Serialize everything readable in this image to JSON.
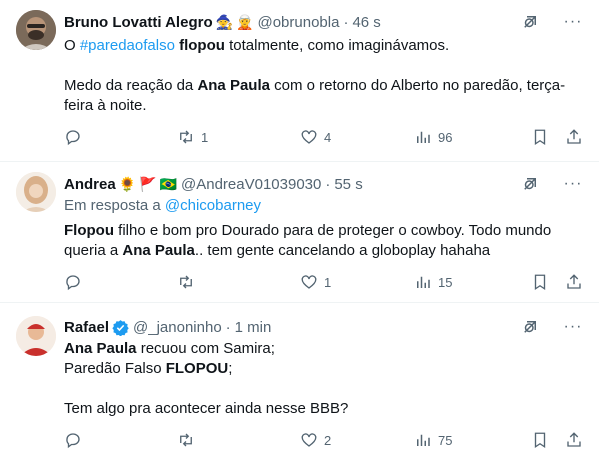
{
  "tweets": [
    {
      "name": "Bruno Lovatti Alegro",
      "name_emojis": [
        "🧙",
        "🧝"
      ],
      "handle": "@obrunobla",
      "separator": "·",
      "time": "46 s",
      "avatar_colors": [
        "#5a4a3c",
        "#b89478"
      ],
      "body": {
        "line1_pre": "O ",
        "line1_hashtag": "#paredaofalso",
        "line1_space": " ",
        "line1_bold": "flopou",
        "line1_post": " totalmente, como imaginávamos.",
        "line2_pre": "Medo da reação da ",
        "line2_bold": "Ana Paula",
        "line2_post": " com o retorno do Alberto no paredão, terça-feira à noite."
      },
      "actions": {
        "reply_count": "",
        "retweet_count": "1",
        "like_count": "4",
        "views_count": "96"
      }
    },
    {
      "name": "Andrea",
      "name_emojis": [
        "🌻",
        "🚩",
        "🇧🇷"
      ],
      "handle": "@AndreaV01039030",
      "separator": "·",
      "time": "55 s",
      "avatar_colors": [
        "#e9d9c8",
        "#c79e7a"
      ],
      "replying_prefix": "Em resposta a ",
      "replying_to": "@chicobarney",
      "body": {
        "bold1": "Flopou",
        "text1": " filho e bom pro Dourado para de proteger o cowboy.  Todo mundo queria a ",
        "bold2": "Ana Paula",
        "text2": ".. tem gente cancelando a globoplay hahaha"
      },
      "actions": {
        "reply_count": "",
        "retweet_count": "",
        "like_count": "1",
        "views_count": "15"
      }
    },
    {
      "name": "Rafael",
      "verified": true,
      "handle": "@_janoninho",
      "separator": "·",
      "time": "1 min",
      "avatar_colors": [
        "#c9302c",
        "#f1d3be"
      ],
      "body": {
        "l1_bold": "Ana Paula",
        "l1_text": " recuou com Samira;",
        "l2_text": "Paredão Falso ",
        "l2_bold": "FLOPOU",
        "l2_end": ";",
        "l3_text": "Tem algo pra acontecer ainda nesse BBB?"
      },
      "actions": {
        "reply_count": "",
        "retweet_count": "",
        "like_count": "2",
        "views_count": "75"
      }
    }
  ],
  "icons": {
    "reply": "reply-icon",
    "retweet": "retweet-icon",
    "like": "heart-icon",
    "views": "views-icon",
    "bookmark": "bookmark-icon",
    "share": "share-icon",
    "grok": "grok-icon",
    "more": "more-icon"
  },
  "colors": {
    "text": "#0f1419",
    "secondary": "#536471",
    "link": "#1d9bf0",
    "verified": "#1d9bf0",
    "divider": "#eff3f4"
  }
}
